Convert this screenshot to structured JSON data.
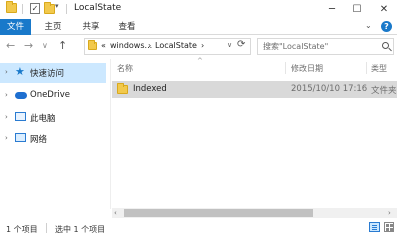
{
  "window": {
    "title": "LocalState",
    "qa_dropdown": "▾",
    "minimize": "─",
    "maximize": "☐",
    "close": "✕"
  },
  "ribbon": {
    "tabs": [
      {
        "label": "文件"
      },
      {
        "label": "主页"
      },
      {
        "label": "共享"
      },
      {
        "label": "查看"
      }
    ],
    "expand": "⌄",
    "help": "?",
    "accent_color": "#1979ca"
  },
  "navigation": {
    "back": "←",
    "forward": "→",
    "recent": "∨",
    "up": "↑",
    "breadcrumbs": [
      "«",
      "windows...",
      "›",
      "LocalState",
      "›"
    ],
    "address_dropdown": "∨",
    "refresh": "⟳"
  },
  "search": {
    "placeholder": "搜索\"LocalState\""
  },
  "sidebar": {
    "items": [
      {
        "label": "快速访问",
        "icon": "star-icon",
        "selected": true
      },
      {
        "label": "OneDrive",
        "icon": "cloud-icon"
      },
      {
        "label": "此电脑",
        "icon": "computer-icon"
      },
      {
        "label": "网络",
        "icon": "network-icon"
      }
    ],
    "expand_arrow": "›",
    "selection_color": "#cce8ff"
  },
  "columns": {
    "name": "名称",
    "date": "修改日期",
    "type": "类型",
    "sort_indicator": "^"
  },
  "files": [
    {
      "name": "Indexed",
      "date": "2015/10/10 17:16",
      "type": "文件夹",
      "icon": "folder-icon"
    }
  ],
  "scrollbar": {
    "left": "‹",
    "right": "›"
  },
  "status": {
    "item_count": "1 个项目",
    "selected": "选中 1 个项目"
  }
}
